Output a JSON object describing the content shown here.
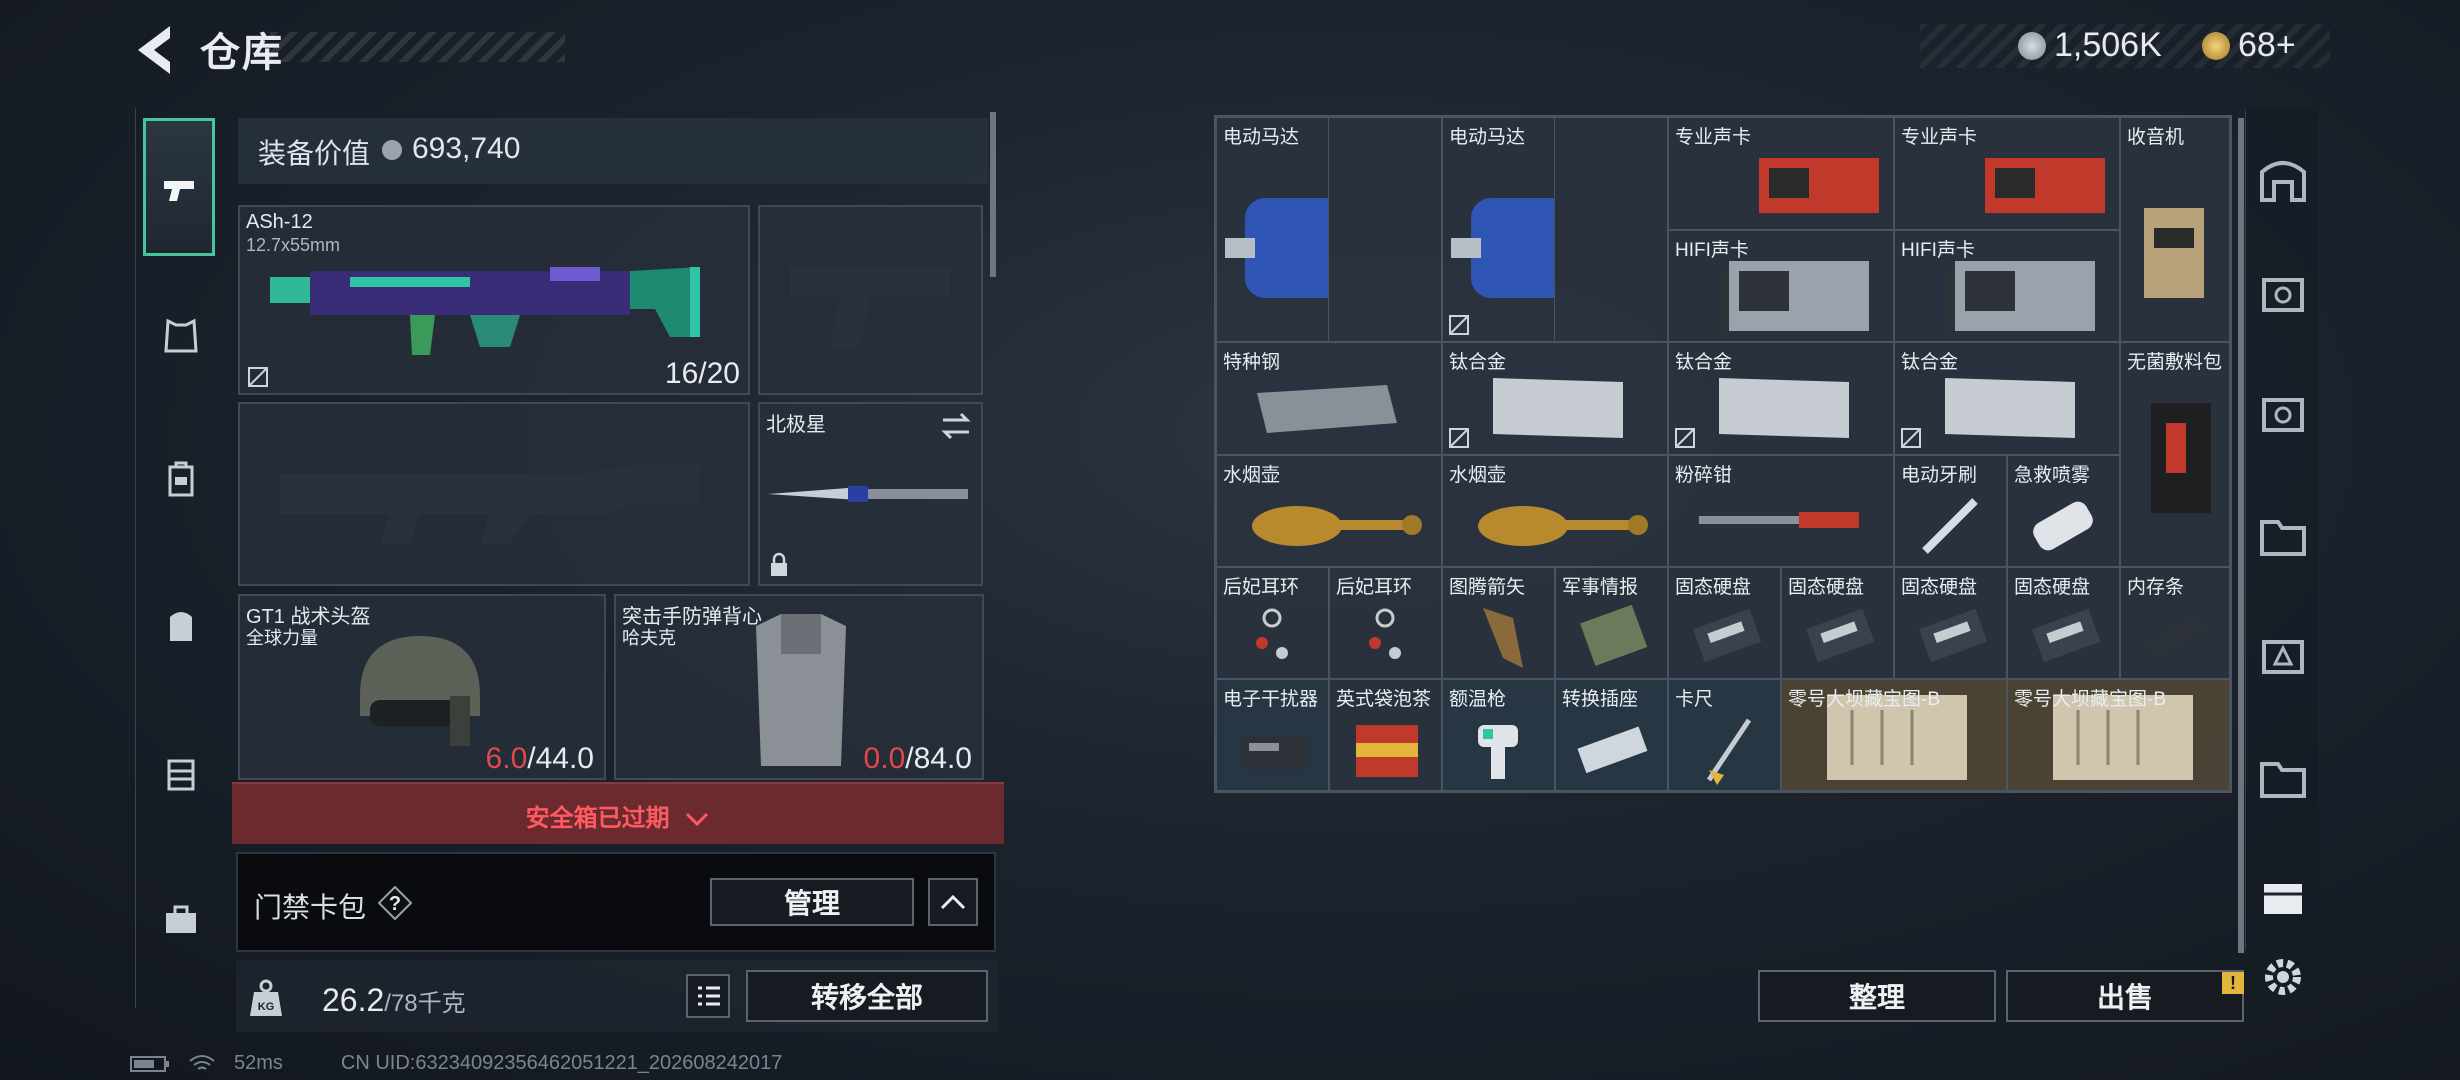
{
  "header": {
    "title": "仓库",
    "silver": "1,506K",
    "gold": "68+"
  },
  "equipment": {
    "label": "装备价值",
    "value": "693,740"
  },
  "weapon_primary": {
    "name": "ASh-12",
    "caliber": "12.7x55mm",
    "ammo": "16/20"
  },
  "melee": {
    "name": "北极星"
  },
  "helmet": {
    "name": "GT1 战术头盔",
    "sub": "全球力量",
    "current": "6.0",
    "max": "/44.0"
  },
  "vest": {
    "name": "突击手防弹背心",
    "sub": "哈夫克",
    "current": "0.0",
    "max": "/84.0"
  },
  "safe_box": {
    "text": "安全箱已过期"
  },
  "keycard": {
    "label": "门禁卡包",
    "help": "?",
    "manage": "管理"
  },
  "weight": {
    "value": "26.2",
    "unit": "/78千克",
    "kg_icon": "KG"
  },
  "actions": {
    "transfer_all": "转移全部",
    "sort": "整理",
    "sell": "出售",
    "sell_badge": "!"
  },
  "status": {
    "ping": "52ms",
    "uid": "CN UID:632340923564620512​21_202608242017"
  },
  "stash": {
    "items": [
      {
        "name": "电动马达"
      },
      {
        "name": "电动马达"
      },
      {
        "name": "专业声卡"
      },
      {
        "name": "专业声卡"
      },
      {
        "name": "收音机"
      },
      {
        "name": "HIFI声卡"
      },
      {
        "name": "HIFI声卡"
      },
      {
        "name": "特种钢"
      },
      {
        "name": "钛合金"
      },
      {
        "name": "钛合金"
      },
      {
        "name": "钛合金"
      },
      {
        "name": "无菌敷料包"
      },
      {
        "name": "水烟壶"
      },
      {
        "name": "水烟壶"
      },
      {
        "name": "粉碎钳"
      },
      {
        "name": "电动牙刷"
      },
      {
        "name": "急救喷雾"
      },
      {
        "name": "后妃耳环"
      },
      {
        "name": "后妃耳环"
      },
      {
        "name": "图腾箭矢"
      },
      {
        "name": "军事情报"
      },
      {
        "name": "固态硬盘"
      },
      {
        "name": "固态硬盘"
      },
      {
        "name": "固态硬盘"
      },
      {
        "name": "固态硬盘"
      },
      {
        "name": "内存条"
      },
      {
        "name": "电子干扰器"
      },
      {
        "name": "英式袋泡茶"
      },
      {
        "name": "额温枪"
      },
      {
        "name": "转换插座"
      },
      {
        "name": "卡尺"
      },
      {
        "name": "零号大坝藏宝图-B"
      },
      {
        "name": "零号大坝藏宝图-B"
      }
    ]
  },
  "colors": {
    "accent": "#46c59a",
    "danger": "#e2474b",
    "expired_bg": "#6a2a2e",
    "badge": "#e2b53c"
  }
}
